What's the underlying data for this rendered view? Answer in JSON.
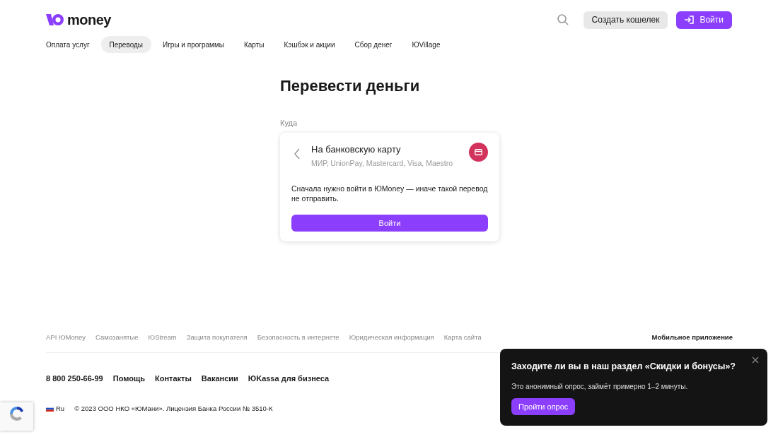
{
  "header": {
    "logo_text": "money",
    "create_wallet": "Создать кошелек",
    "login": "Войти"
  },
  "nav": [
    {
      "label": "Оплата услуг",
      "selected": false
    },
    {
      "label": "Переводы",
      "selected": true
    },
    {
      "label": "Игры и программы",
      "selected": false
    },
    {
      "label": "Карты",
      "selected": false
    },
    {
      "label": "Кэшбэк и акции",
      "selected": false
    },
    {
      "label": "Сбор денег",
      "selected": false
    },
    {
      "label": "ЮVillage",
      "selected": false
    }
  ],
  "page_title": "Перевести деньги",
  "field_label": "Куда",
  "card": {
    "title": "На банковскую карту",
    "subtitle": "МИР, UnionPay, Mastercard, Visa, Maestro",
    "message": "Сначала нужно войти в ЮMoney — иначе такой перевод не отправить.",
    "button": "Войти"
  },
  "footer": {
    "links": [
      "API ЮMoney",
      "Самозанятые",
      "ЮStream",
      "Защита покупателя",
      "Безопасность в интернете",
      "Юридическая информация",
      "Карта сайта"
    ],
    "mobile_app": "Мобильное приложение",
    "main_links": [
      "8 800 250-66-99",
      "Помощь",
      "Контакты",
      "Вакансии",
      "ЮKassa для бизнеса"
    ],
    "language": "Ru",
    "copyright": "© 2023 ООО НКО «ЮМани». Лицензия Банка России № 3510-К"
  },
  "survey": {
    "title": "Заходите ли вы в наш раздел «Скидки и бонусы»?",
    "text": "Это анонимный опрос, займёт примерно 1–2 минуты.",
    "button": "Пройти опрос"
  }
}
